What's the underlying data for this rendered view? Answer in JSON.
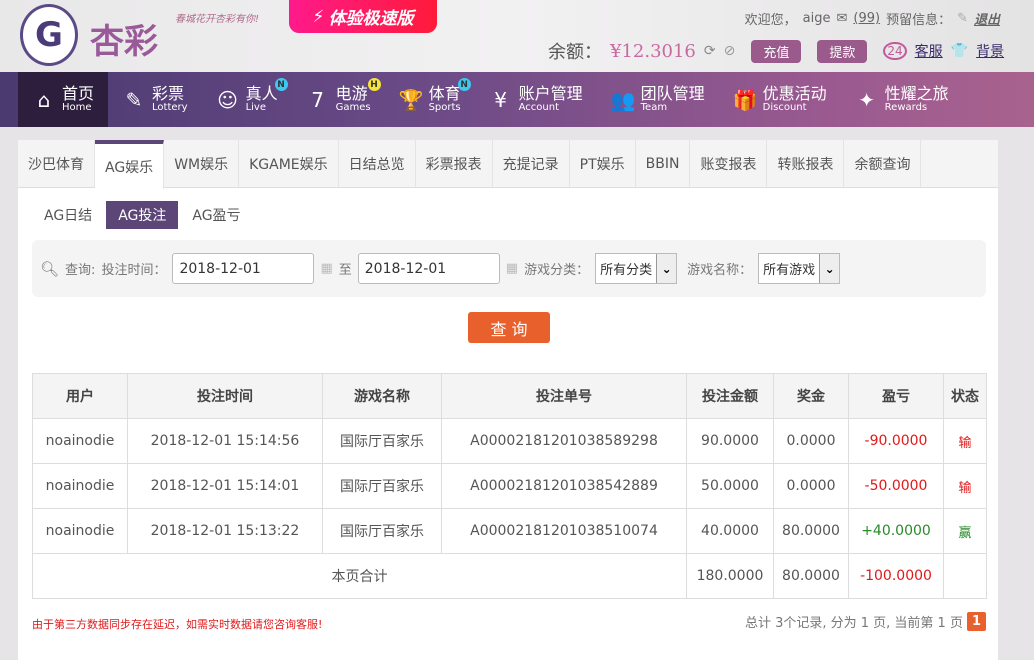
{
  "brand": {
    "logo_letter": "G",
    "name": "杏彩",
    "slogan": "春城花开杏彩有你!",
    "promo": "体验极速版"
  },
  "user": {
    "welcome": "欢迎您，",
    "name": "aige",
    "mail_count": "(99)",
    "reserved": "预留信息：",
    "logout": "退出",
    "balance_label": "余额：",
    "balance": "¥12.3016",
    "deposit": "充值",
    "withdraw": "提款",
    "service": "客服",
    "background": "背景"
  },
  "nav": [
    {
      "zh": "首页",
      "en": "Home",
      "icon": "⌂"
    },
    {
      "zh": "彩票",
      "en": "Lottery",
      "icon": "✎"
    },
    {
      "zh": "真人",
      "en": "Live",
      "icon": "☺",
      "badge": "N"
    },
    {
      "zh": "电游",
      "en": "Games",
      "icon": "7",
      "badge": "H"
    },
    {
      "zh": "体育",
      "en": "Sports",
      "icon": "🏆",
      "badge": "N"
    },
    {
      "zh": "账户管理",
      "en": "Account",
      "icon": "¥"
    },
    {
      "zh": "团队管理",
      "en": "Team",
      "icon": "👥"
    },
    {
      "zh": "优惠活动",
      "en": "Discount",
      "icon": "🎁"
    },
    {
      "zh": "性耀之旅",
      "en": "Rewards",
      "icon": "✦"
    }
  ],
  "tabs": [
    "沙巴体育",
    "AG娱乐",
    "WM娱乐",
    "KGAME娱乐",
    "日结总览",
    "彩票报表",
    "充提记录",
    "PT娱乐",
    "BBIN",
    "账变报表",
    "转账报表",
    "余额查询"
  ],
  "subtabs": [
    "AG日结",
    "AG投注",
    "AG盈亏"
  ],
  "filter": {
    "query": "查询:",
    "time_label": "投注时间：",
    "from": "2018-12-01",
    "to_label": "至",
    "to": "2018-12-01",
    "cat_label": "游戏分类：",
    "cat": "所有分类",
    "name_label": "游戏名称：",
    "name": "所有游戏",
    "button": "查 询"
  },
  "table": {
    "headers": [
      "用户",
      "投注时间",
      "游戏名称",
      "投注单号",
      "投注金额",
      "奖金",
      "盈亏",
      "状态"
    ],
    "rows": [
      [
        "noainodie",
        "2018-12-01 15:14:56",
        "国际厅百家乐",
        "A00002181201038589298",
        "90.0000",
        "0.0000",
        "-90.0000",
        "输"
      ],
      [
        "noainodie",
        "2018-12-01 15:14:01",
        "国际厅百家乐",
        "A00002181201038542889",
        "50.0000",
        "0.0000",
        "-50.0000",
        "输"
      ],
      [
        "noainodie",
        "2018-12-01 15:13:22",
        "国际厅百家乐",
        "A00002181201038510074",
        "40.0000",
        "80.0000",
        "+40.0000",
        "赢"
      ]
    ],
    "total": {
      "label": "本页合计",
      "bet": "180.0000",
      "bonus": "80.0000",
      "pl": "-100.0000"
    }
  },
  "note": "由于第三方数据同步存在延迟，如需实时数据请您咨询客服!",
  "pager": {
    "summary": "总计 3个记录, 分为 1 页, 当前第 1 页",
    "page": "1"
  }
}
